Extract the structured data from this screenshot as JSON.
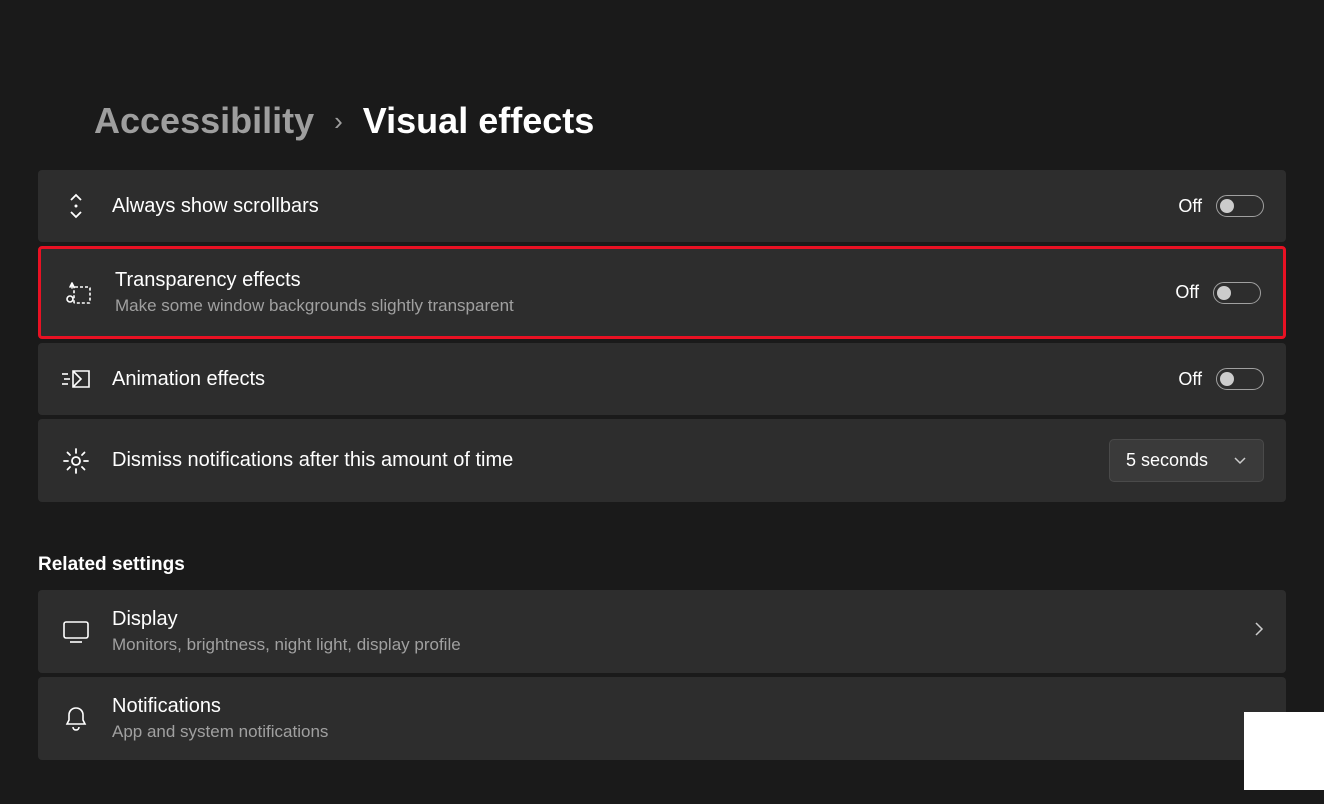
{
  "breadcrumb": {
    "parent": "Accessibility",
    "current": "Visual effects"
  },
  "settings": {
    "scrollbars": {
      "title": "Always show scrollbars",
      "state": "Off"
    },
    "transparency": {
      "title": "Transparency effects",
      "subtitle": "Make some window backgrounds slightly transparent",
      "state": "Off"
    },
    "animation": {
      "title": "Animation effects",
      "state": "Off"
    },
    "dismiss": {
      "title": "Dismiss notifications after this amount of time",
      "value": "5 seconds"
    }
  },
  "related": {
    "heading": "Related settings",
    "display": {
      "title": "Display",
      "subtitle": "Monitors, brightness, night light, display profile"
    },
    "notifications": {
      "title": "Notifications",
      "subtitle": "App and system notifications"
    }
  }
}
